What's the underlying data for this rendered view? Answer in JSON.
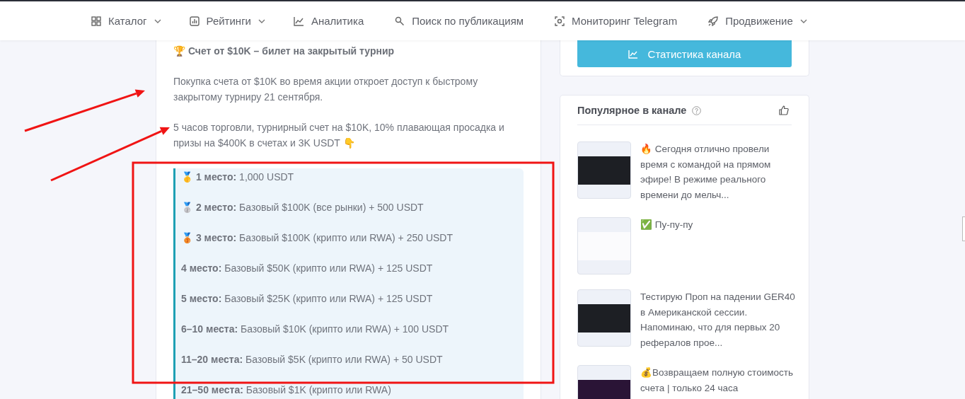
{
  "nav": {
    "items": [
      {
        "label": "Каталог",
        "dropdown": true
      },
      {
        "label": "Рейтинги",
        "dropdown": true
      },
      {
        "label": "Аналитика",
        "dropdown": false
      },
      {
        "label": "Поиск по публикациям",
        "dropdown": false
      },
      {
        "label": "Мониторинг Telegram",
        "dropdown": false
      },
      {
        "label": "Продвижение",
        "dropdown": true
      }
    ]
  },
  "post": {
    "heading": "🏆 Счет от $10K – билет на закрытый турнир",
    "paragraphs": [
      "Покупка счета от $10K во время акции откроет доступ к быстрому закрытому турниру 21 сентября.",
      "5 часов торговли, турнирный счет на $10K, 10% плавающая просадка и призы на $400K в счетах и 3K USDT 👇"
    ],
    "prizes": [
      "🥇 **1 место:** 1,000 USDT",
      "🥈 **2 место:** Базовый $100K (все рынки) + 500 USDT",
      "🥉 **3 место:** Базовый $100K (крипто или RWA) + 250 USDT",
      "**4 место:** Базовый $50K (крипто или RWA) + 125 USDT",
      "**5 место:** Базовый $25K (крипто или RWA) + 125 USDT",
      "**6–10 места:** Базовый $10K (крипто или RWA) + 100 USDT",
      "**11–20 места:** Базовый $5K (крипто или RWA) + 50 USDT",
      "**21–50 места:** Базовый $1K (крипто или RWA)"
    ]
  },
  "sidebar": {
    "stats_button": "Статистика канала",
    "popular": {
      "title": "Популярное в канале",
      "items": [
        {
          "text": "🔥 Сегодня отлично провели время с командой на прямом эфире! В режиме реального времени до мельч..."
        },
        {
          "text": "✅ Пу-пу-пу"
        },
        {
          "text": "Тестирую Проп на падении GER40 в Американской сессии. Напоминаю, что для первых 20 рефералов прое..."
        },
        {
          "text": "💰Возвращаем полную стоимость счета | только 24 часа"
        }
      ]
    }
  },
  "annotations": [
    {
      "kind": "arrow"
    },
    {
      "kind": "arrow"
    },
    {
      "kind": "frame"
    }
  ]
}
